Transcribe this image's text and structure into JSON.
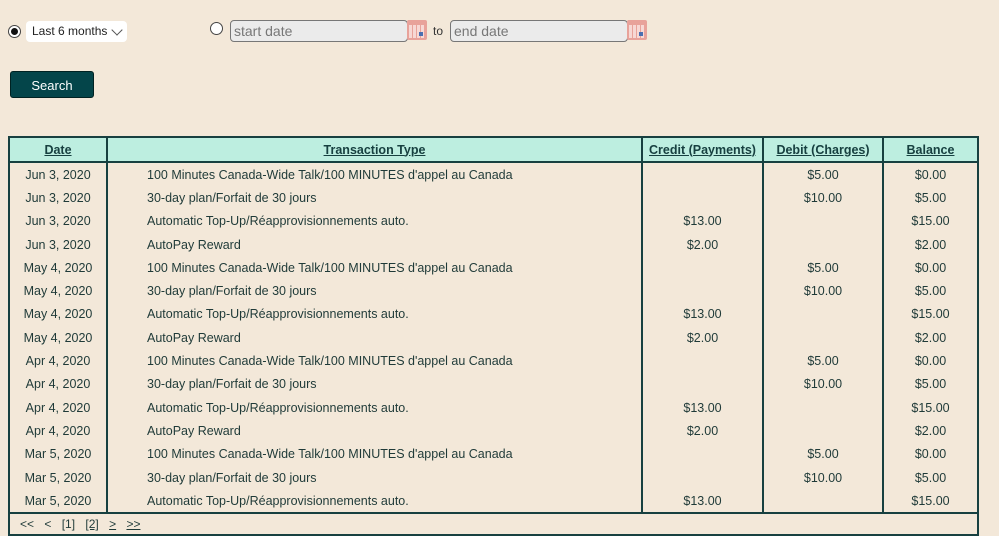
{
  "filter": {
    "period_option_selected": true,
    "period_value": "Last 6 months",
    "range_option_selected": false,
    "start_placeholder": "start date",
    "to_label": "to",
    "end_placeholder": "end date"
  },
  "search_label": "Search",
  "table": {
    "headers": [
      "Date",
      "Transaction Type",
      "Credit (Payments)",
      "Debit (Charges)",
      "Balance"
    ],
    "rows": [
      {
        "date": "Jun 3, 2020",
        "type": "100 Minutes Canada-Wide Talk/100 MINUTES d'appel au Canada",
        "credit": "",
        "debit": "$5.00",
        "balance": "$0.00"
      },
      {
        "date": "Jun 3, 2020",
        "type": "30-day plan/Forfait de 30 jours",
        "credit": "",
        "debit": "$10.00",
        "balance": "$5.00"
      },
      {
        "date": "Jun 3, 2020",
        "type": "Automatic Top-Up/Réapprovisionnements auto.",
        "credit": "$13.00",
        "debit": "",
        "balance": "$15.00"
      },
      {
        "date": "Jun 3, 2020",
        "type": "AutoPay Reward",
        "credit": "$2.00",
        "debit": "",
        "balance": "$2.00"
      },
      {
        "date": "May 4, 2020",
        "type": "100 Minutes Canada-Wide Talk/100 MINUTES d'appel au Canada",
        "credit": "",
        "debit": "$5.00",
        "balance": "$0.00"
      },
      {
        "date": "May 4, 2020",
        "type": "30-day plan/Forfait de 30 jours",
        "credit": "",
        "debit": "$10.00",
        "balance": "$5.00"
      },
      {
        "date": "May 4, 2020",
        "type": "Automatic Top-Up/Réapprovisionnements auto.",
        "credit": "$13.00",
        "debit": "",
        "balance": "$15.00"
      },
      {
        "date": "May 4, 2020",
        "type": "AutoPay Reward",
        "credit": "$2.00",
        "debit": "",
        "balance": "$2.00"
      },
      {
        "date": "Apr 4, 2020",
        "type": "100 Minutes Canada-Wide Talk/100 MINUTES d'appel au Canada",
        "credit": "",
        "debit": "$5.00",
        "balance": "$0.00"
      },
      {
        "date": "Apr 4, 2020",
        "type": "30-day plan/Forfait de 30 jours",
        "credit": "",
        "debit": "$10.00",
        "balance": "$5.00"
      },
      {
        "date": "Apr 4, 2020",
        "type": "Automatic Top-Up/Réapprovisionnements auto.",
        "credit": "$13.00",
        "debit": "",
        "balance": "$15.00"
      },
      {
        "date": "Apr 4, 2020",
        "type": "AutoPay Reward",
        "credit": "$2.00",
        "debit": "",
        "balance": "$2.00"
      },
      {
        "date": "Mar 5, 2020",
        "type": "100 Minutes Canada-Wide Talk/100 MINUTES d'appel au Canada",
        "credit": "",
        "debit": "$5.00",
        "balance": "$0.00"
      },
      {
        "date": "Mar 5, 2020",
        "type": "30-day plan/Forfait de 30 jours",
        "credit": "",
        "debit": "$10.00",
        "balance": "$5.00"
      },
      {
        "date": "Mar 5, 2020",
        "type": "Automatic Top-Up/Réapprovisionnements auto.",
        "credit": "$13.00",
        "debit": "",
        "balance": "$15.00"
      }
    ]
  },
  "pager": {
    "first": "<<",
    "prev": "<",
    "pages": [
      "[1]",
      "[2]"
    ],
    "next": ">",
    "last": ">>"
  }
}
